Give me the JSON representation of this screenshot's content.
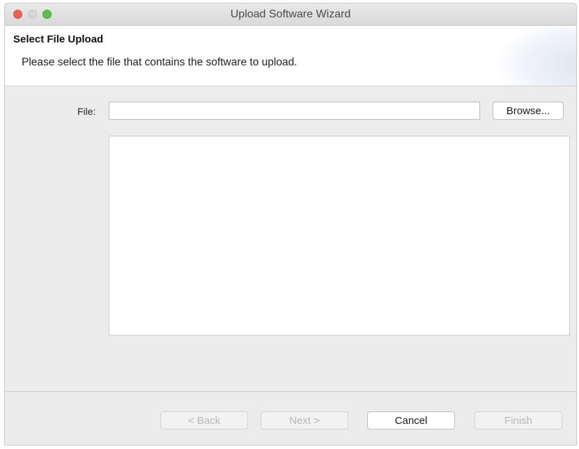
{
  "window": {
    "title": "Upload Software Wizard"
  },
  "header": {
    "title": "Select File Upload",
    "description": "Please select the file that contains the software to upload."
  },
  "form": {
    "file_label": "File:",
    "file_value": "",
    "browse_label": "Browse..."
  },
  "footer": {
    "back_label": "< Back",
    "next_label": "Next >",
    "cancel_label": "Cancel",
    "finish_label": "Finish"
  },
  "colors": {
    "close": "#ee5f56",
    "minimize": "#d6d6d6",
    "maximize": "#5ac245",
    "window_bg": "#ececec"
  }
}
